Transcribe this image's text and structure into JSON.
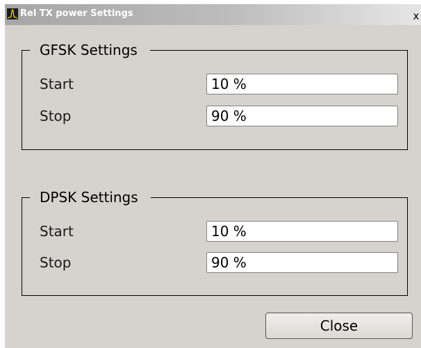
{
  "window": {
    "title": "Rel TX power Settings",
    "close_glyph": "x",
    "icon": "spectrum-app-icon"
  },
  "groups": [
    {
      "legend": "GFSK Settings",
      "rows": [
        {
          "label": "Start",
          "value": "10 %"
        },
        {
          "label": "Stop",
          "value": "90 %"
        }
      ]
    },
    {
      "legend": "DPSK Settings",
      "rows": [
        {
          "label": "Start",
          "value": "10 %"
        },
        {
          "label": "Stop",
          "value": "90 %"
        }
      ]
    }
  ],
  "buttons": {
    "close_label": "Close"
  },
  "colors": {
    "window_bg": "#d6d3ce",
    "field_bg": "#ffffff",
    "title_text": "#ffffff"
  }
}
